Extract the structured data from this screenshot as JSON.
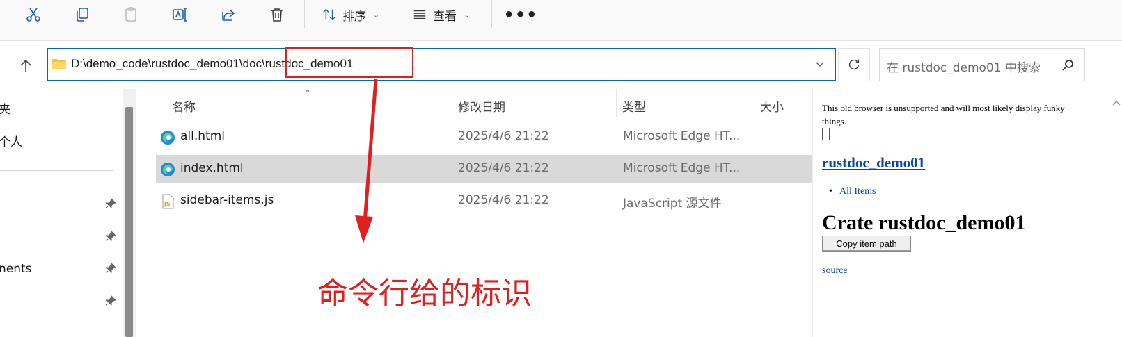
{
  "toolbar": {
    "cut_icon": "scissors-icon",
    "copy_icon": "copy-icon",
    "paste_icon": "clipboard-icon",
    "rename_icon": "rename-icon",
    "share_icon": "share-icon",
    "delete_icon": "trash-icon",
    "sort_label": "排序",
    "view_label": "查看",
    "more_label": "•••"
  },
  "address": {
    "path_prefix": "D:\\demo_code\\rustdoc_demo01\\doc",
    "path_highlight": "\\rustdoc_demo01"
  },
  "search": {
    "placeholder": "在 rustdoc_demo01 中搜索"
  },
  "nav": {
    "items": [
      "夹",
      "个人",
      "nents"
    ]
  },
  "columns": {
    "name": "名称",
    "date": "修改日期",
    "type": "类型",
    "size": "大小"
  },
  "files": [
    {
      "name": "all.html",
      "date": "2025/4/6 21:22",
      "type": "Microsoft Edge HT...",
      "icon": "edge-icon",
      "selected": false
    },
    {
      "name": "index.html",
      "date": "2025/4/6 21:22",
      "type": "Microsoft Edge HT...",
      "icon": "edge-icon",
      "selected": true
    },
    {
      "name": "sidebar-items.js",
      "date": "2025/4/6 21:22",
      "type": "JavaScript 源文件",
      "icon": "js-file-icon",
      "selected": false
    }
  ],
  "annotation": {
    "text": "命令行给的标识",
    "color": "#e02020"
  },
  "preview": {
    "warning": "This old browser is unsupported and will most likely display funky things.",
    "crate_link": "rustdoc_demo01",
    "all_items": "All Items",
    "title": "Crate rustdoc_demo01",
    "copy_button": "Copy item path",
    "source_link": "source"
  },
  "colors": {
    "accent": "#0067c0",
    "selection": "#d9d9d9",
    "link": "#0645ad"
  }
}
